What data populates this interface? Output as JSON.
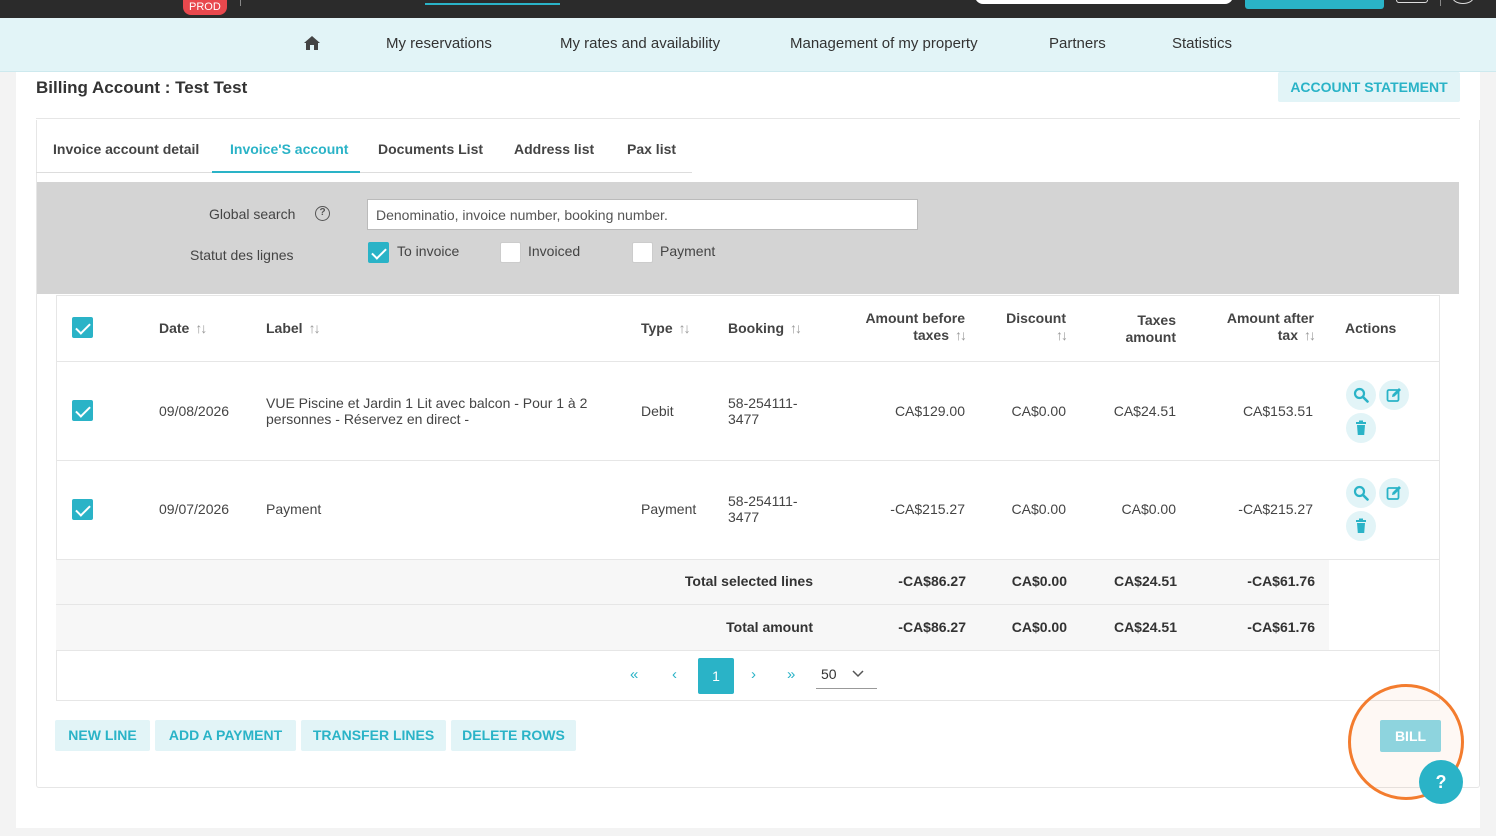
{
  "topbar": {
    "env_badge": "PROD"
  },
  "nav": {
    "items": [
      "My reservations",
      "My rates and availability",
      "Management of my property",
      "Partners",
      "Statistics"
    ]
  },
  "page": {
    "title": "Billing Account : Test Test",
    "account_statement_label": "ACCOUNT STATEMENT"
  },
  "tabs": [
    {
      "label": "Invoice account detail",
      "active": false
    },
    {
      "label": "Invoice'S account",
      "active": true
    },
    {
      "label": "Documents List",
      "active": false
    },
    {
      "label": "Address list",
      "active": false
    },
    {
      "label": "Pax list",
      "active": false
    }
  ],
  "filters": {
    "global_search_label": "Global search",
    "search_placeholder": "Denominatio, invoice number, booking number.",
    "status_label": "Statut des lignes",
    "statuses": [
      {
        "label": "To invoice",
        "checked": true
      },
      {
        "label": "Invoiced",
        "checked": false
      },
      {
        "label": "Payment",
        "checked": false
      }
    ]
  },
  "table": {
    "headers": {
      "date": "Date",
      "label": "Label",
      "type": "Type",
      "booking": "Booking",
      "amount_before_1": "Amount before",
      "amount_before_2": "taxes",
      "discount": "Discount",
      "taxes_1": "Taxes",
      "taxes_2": "amount",
      "amount_after_1": "Amount after",
      "amount_after_2": "tax",
      "actions": "Actions"
    },
    "rows": [
      {
        "date": "09/08/2026",
        "label_1": "VUE Piscine et Jardin 1 Lit avec balcon - Pour 1 à 2",
        "label_2": "personnes - Réservez en direct -",
        "type": "Debit",
        "booking_1": "58-254111-",
        "booking_2": "3477",
        "amount_before": "CA$129.00",
        "discount": "CA$0.00",
        "taxes": "CA$24.51",
        "amount_after": "CA$153.51"
      },
      {
        "date": "09/07/2026",
        "label_1": "Payment",
        "label_2": "",
        "type": "Payment",
        "booking_1": "58-254111-",
        "booking_2": "3477",
        "amount_before": "-CA$215.27",
        "discount": "CA$0.00",
        "taxes": "CA$0.00",
        "amount_after": "-CA$215.27"
      }
    ],
    "totals": [
      {
        "label": "Total selected lines",
        "amount_before": "-CA$86.27",
        "discount": "CA$0.00",
        "taxes": "CA$24.51",
        "amount_after": "-CA$61.76"
      },
      {
        "label": "Total amount",
        "amount_before": "-CA$86.27",
        "discount": "CA$0.00",
        "taxes": "CA$24.51",
        "amount_after": "-CA$61.76"
      }
    ]
  },
  "pager": {
    "first": "«",
    "prev": "‹",
    "current": "1",
    "next": "›",
    "last": "»",
    "per_page": "50"
  },
  "actions": {
    "new_line": "NEW LINE",
    "add_payment": "ADD A PAYMENT",
    "transfer_lines": "TRANSFER LINES",
    "delete_rows": "DELETE ROWS",
    "bill": "BILL",
    "help": "?"
  },
  "colors": {
    "accent": "#2ab3c7",
    "nav_bg": "#e2f4f7",
    "highlight": "#f37c2e"
  }
}
